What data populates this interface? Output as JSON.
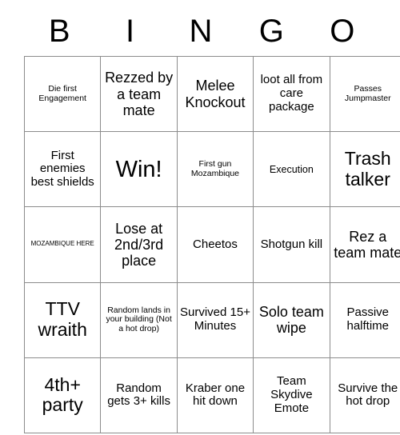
{
  "card": {
    "title": "BINGO",
    "header_letters": [
      "B",
      "I",
      "N",
      "G",
      "O"
    ],
    "grid_border_color": "#8c8c8c",
    "text_color": "#000000",
    "background_color": "#ffffff",
    "columns": 5,
    "rows": 5,
    "cells": [
      [
        {
          "text": "Die first Engagement",
          "size": "fs-xs"
        },
        {
          "text": "Rezzed by a team mate",
          "size": "fs-l"
        },
        {
          "text": "Melee Knockout",
          "size": "fs-l"
        },
        {
          "text": "loot all from care package",
          "size": "fs-m"
        },
        {
          "text": "Passes Jumpmaster",
          "size": "fs-xs"
        }
      ],
      [
        {
          "text": "First enemies best shields",
          "size": "fs-m"
        },
        {
          "text": "Win!",
          "size": "fs-xxl"
        },
        {
          "text": "First gun Mozambique",
          "size": "fs-xs"
        },
        {
          "text": "Execution",
          "size": "fs-s"
        },
        {
          "text": "Trash talker",
          "size": "fs-xl"
        }
      ],
      [
        {
          "text": "MOZAMBIQUE HERE",
          "size": "fs-xxs"
        },
        {
          "text": "Lose at 2nd/3rd place",
          "size": "fs-l"
        },
        {
          "text": "Cheetos",
          "size": "fs-m"
        },
        {
          "text": "Shotgun kill",
          "size": "fs-m"
        },
        {
          "text": "Rez a team mate",
          "size": "fs-l"
        }
      ],
      [
        {
          "text": "TTV wraith",
          "size": "fs-xl"
        },
        {
          "text": "Random lands in your building (Not a hot drop)",
          "size": "fs-xs"
        },
        {
          "text": "Survived 15+ Minutes",
          "size": "fs-m"
        },
        {
          "text": "Solo team wipe",
          "size": "fs-l"
        },
        {
          "text": "Passive halftime",
          "size": "fs-m"
        }
      ],
      [
        {
          "text": "4th+ party",
          "size": "fs-xl"
        },
        {
          "text": "Random gets 3+ kills",
          "size": "fs-m"
        },
        {
          "text": "Kraber one hit down",
          "size": "fs-m"
        },
        {
          "text": "Team Skydive Emote",
          "size": "fs-m"
        },
        {
          "text": "Survive the hot drop",
          "size": "fs-m"
        }
      ]
    ]
  }
}
